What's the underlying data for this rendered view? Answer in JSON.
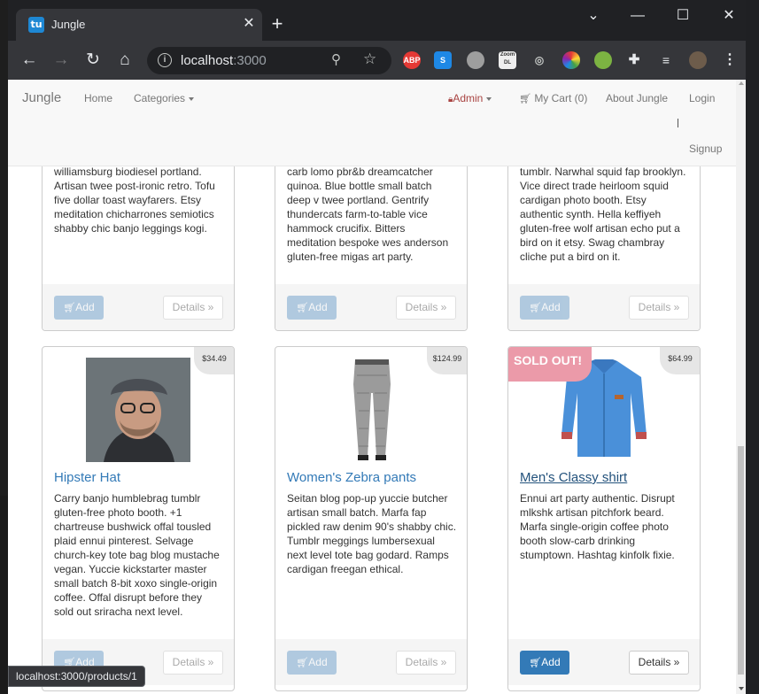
{
  "browser": {
    "tab_title": "Jungle",
    "favicon_label": "tu",
    "url_host": "localhost",
    "url_port": ":3000",
    "status_url": "localhost:3000/products/1",
    "extensions": [
      "abp",
      "s",
      "circle",
      "zoom-dl",
      "mouse",
      "color",
      "frog",
      "puzzle",
      "media",
      "avatar"
    ],
    "ext_labels": {
      "abp": "ABP",
      "s": "S",
      "zoom_dl": "Zoom DL"
    }
  },
  "navbar": {
    "brand": "Jungle",
    "home": "Home",
    "categories": "Categories",
    "admin": "Admin",
    "cart": "My Cart (0)",
    "about": "About Jungle",
    "login": "Login",
    "signup": "Signup"
  },
  "buttons": {
    "add": "Add",
    "details": "Details »"
  },
  "top_row": [
    {
      "description": "williamsburg biodiesel portland. Artisan twee post-ironic retro. Tofu five dollar toast wayfarers. Etsy meditation chicharrones semiotics shabby chic banjo leggings kogi.",
      "add_disabled": true
    },
    {
      "description": "carb lomo pbr&b dreamcatcher quinoa. Blue bottle small batch deep v twee portland. Gentrify thundercats farm-to-table vice hammock crucifix. Bitters meditation bespoke wes anderson gluten-free migas art party.",
      "add_disabled": true
    },
    {
      "description": "tumblr. Narwhal squid fap brooklyn. Vice direct trade heirloom squid cardigan photo booth. Etsy authentic synth. Hella keffiyeh gluten-free wolf artisan echo put a bird on it etsy. Swag chambray cliche put a bird on it.",
      "add_disabled": true
    }
  ],
  "products": [
    {
      "name": "Hipster Hat",
      "price": "$34.49",
      "description": "Carry banjo humblebrag tumblr gluten-free photo booth. +1 chartreuse bushwick offal tousled plaid ennui pinterest. Selvage church-key tote bag blog mustache vegan. Yuccie kickstarter master small batch 8-bit xoxo single-origin coffee. Offal disrupt before they sold out sriracha next level.",
      "sold_out": false
    },
    {
      "name": "Women's Zebra pants",
      "price": "$124.99",
      "description": "Seitan blog pop-up yuccie butcher artisan small batch. Marfa fap pickled raw denim 90's shabby chic. Tumblr meggings lumbersexual next level tote bag godard. Ramps cardigan freegan ethical.",
      "sold_out": false
    },
    {
      "name": "Men's Classy shirt",
      "price": "$64.99",
      "description": "Ennui art party authentic. Disrupt mlkshk artisan pitchfork beard. Marfa single-origin coffee photo booth slow-carb drinking stumptown. Hashtag kinfolk fixie.",
      "sold_out": true,
      "sold_label": "SOLD OUT!"
    }
  ],
  "colors": {
    "primary": "#337ab7",
    "sold_badge": "#eb9aa9",
    "admin": "#a94442"
  }
}
